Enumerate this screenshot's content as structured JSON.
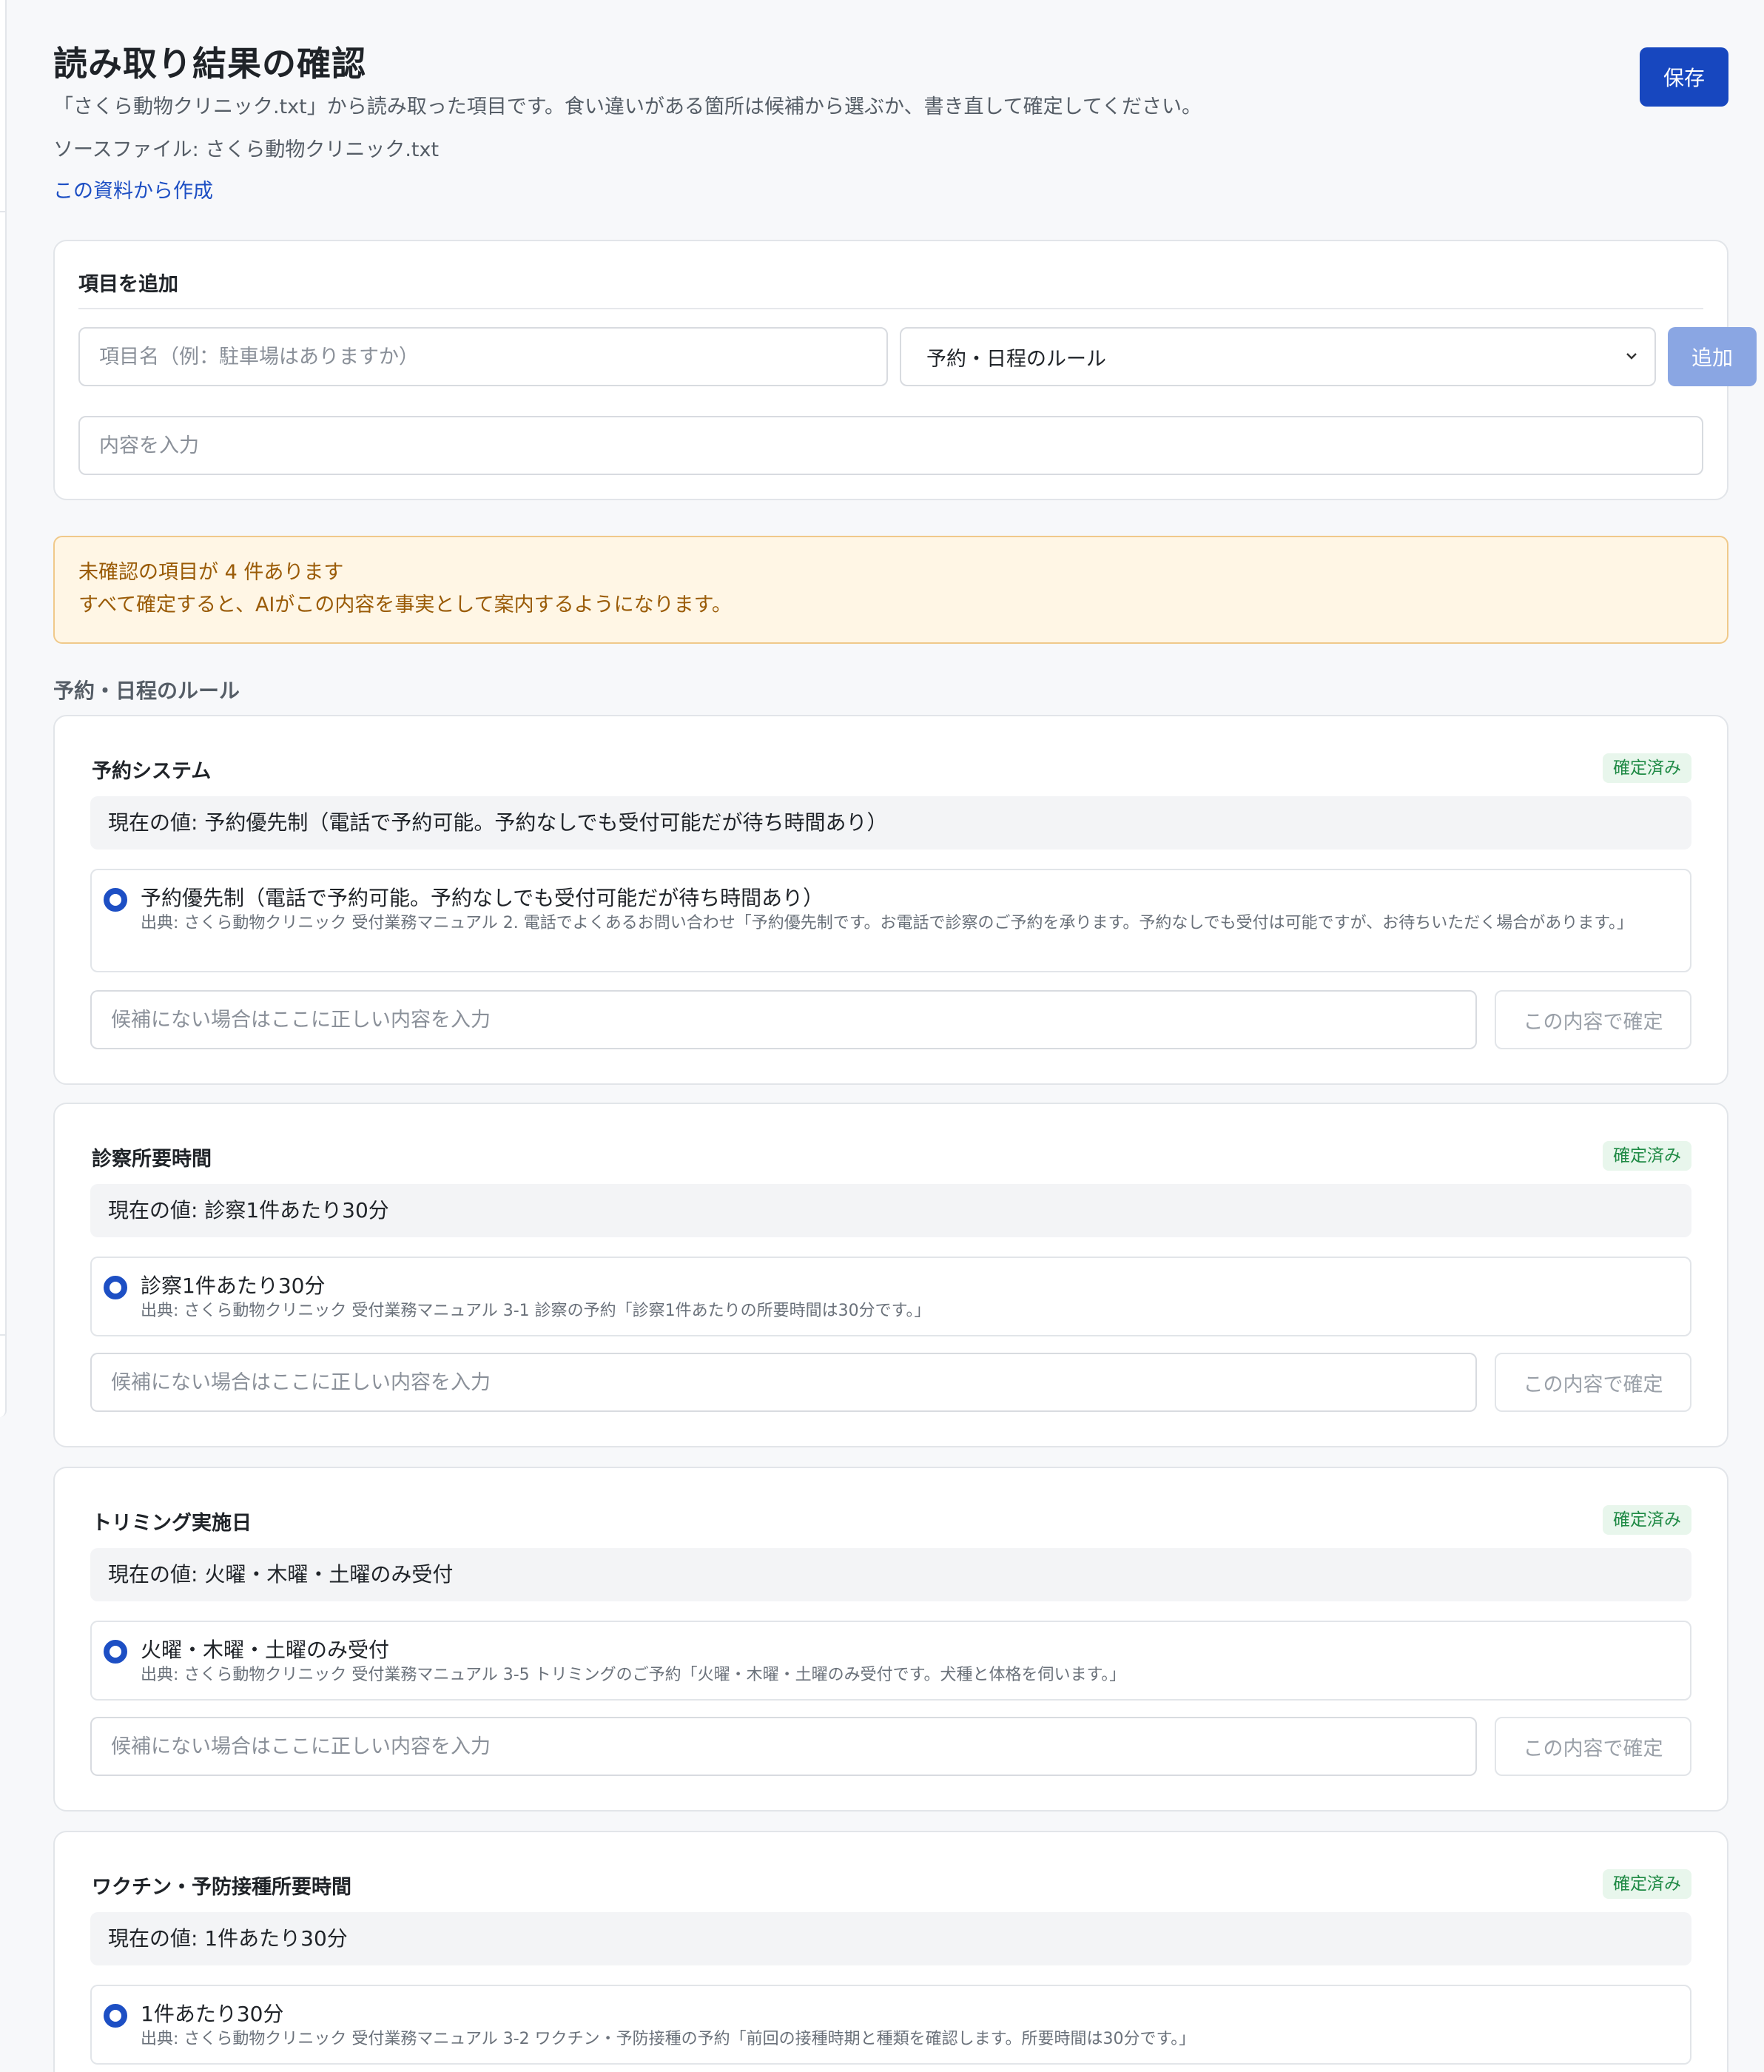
{
  "header": {
    "title": "読み取り結果の確認",
    "description": "「さくら動物クリニック.txt」から読み取った項目です。食い違いがある箇所は候補から選ぶか、書き直して確定してください。",
    "source_file": "ソースファイル: さくら動物クリニック.txt",
    "create_link": "この資料から作成",
    "save_label": "保存"
  },
  "add_item": {
    "title": "項目を追加",
    "name_placeholder": "項目名（例：駐車場はありますか）",
    "category_selected": "予約・日程のルール",
    "add_label": "追加",
    "content_placeholder": "内容を入力"
  },
  "warning": {
    "line1": "未確認の項目が 4 件あります",
    "line2": "すべて確定すると、AIがこの内容を事実として案内するようになります。"
  },
  "section": {
    "heading": "予約・日程のルール"
  },
  "items": [
    {
      "title": "予約システム",
      "status": "確定済み",
      "current": "現在の値: 予約優先制（電話で予約可能。予約なしでも受付可能だが待ち時間あり）",
      "option_value": "予約優先制（電話で予約可能。予約なしでも受付可能だが待ち時間あり）",
      "option_source": "出典: さくら動物クリニック 受付業務マニュアル 2. 電話でよくあるお問い合わせ「予約優先制です。お電話で診察のご予約を承ります。予約なしでも受付は可能ですが、お待ちいただく場合があります。」",
      "input_placeholder": "候補にない場合はここに正しい内容を入力",
      "confirm_label": "この内容で確定"
    },
    {
      "title": "診察所要時間",
      "status": "確定済み",
      "current": "現在の値: 診察1件あたり30分",
      "option_value": "診察1件あたり30分",
      "option_source": "出典: さくら動物クリニック 受付業務マニュアル 3-1 診察の予約「診察1件あたりの所要時間は30分です。」",
      "input_placeholder": "候補にない場合はここに正しい内容を入力",
      "confirm_label": "この内容で確定"
    },
    {
      "title": "トリミング実施日",
      "status": "確定済み",
      "current": "現在の値: 火曜・木曜・土曜のみ受付",
      "option_value": "火曜・木曜・土曜のみ受付",
      "option_source": "出典: さくら動物クリニック 受付業務マニュアル 3-5 トリミングのご予約「火曜・木曜・土曜のみ受付です。犬種と体格を伺います。」",
      "input_placeholder": "候補にない場合はここに正しい内容を入力",
      "confirm_label": "この内容で確定"
    },
    {
      "title": "ワクチン・予防接種所要時間",
      "status": "確定済み",
      "current": "現在の値: 1件あたり30分",
      "option_value": "1件あたり30分",
      "option_source": "出典: さくら動物クリニック 受付業務マニュアル 3-2 ワクチン・予防接種の予約「前回の接種時期と種類を確認します。所要時間は30分です。」"
    }
  ]
}
